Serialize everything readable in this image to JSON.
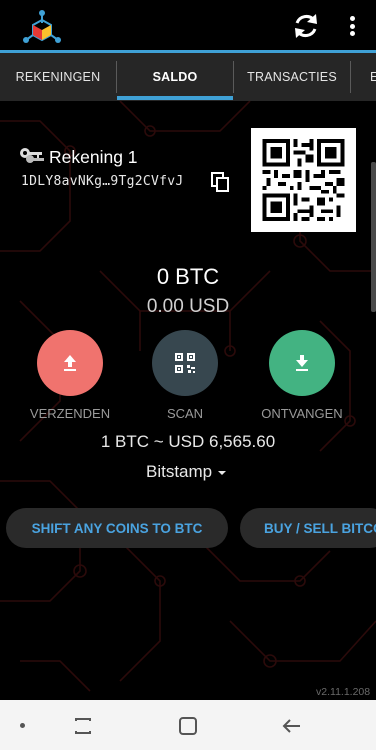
{
  "app": {
    "logo_icon": "app-logo-icon",
    "accent_color": "#3fa1d6"
  },
  "toolbar": {
    "refresh_icon": "refresh-icon",
    "more_icon": "more-vert-icon"
  },
  "tabs": [
    {
      "label": "REKENINGEN",
      "active": false
    },
    {
      "label": "SALDO",
      "active": true
    },
    {
      "label": "TRANSACTIES",
      "active": false
    },
    {
      "label": "E",
      "active": false
    }
  ],
  "account": {
    "icon": "key-icon",
    "name": "Rekening 1",
    "address": "1DLY8avNKg…9Tg2CVfvJ",
    "copy_icon": "copy-icon"
  },
  "balance": {
    "btc": "0 BTC",
    "usd": "0.00 USD"
  },
  "actions": [
    {
      "label": "VERZENDEN",
      "icon": "upload-icon",
      "color": "#f0736e"
    },
    {
      "label": "SCAN",
      "icon": "qr-scan-icon",
      "color": "#37474f"
    },
    {
      "label": "ONTVANGEN",
      "icon": "download-icon",
      "color": "#43b382"
    }
  ],
  "rate": {
    "text": "1 BTC ~ USD 6,565.60",
    "exchange": "Bitstamp"
  },
  "promo": {
    "shift": "SHIFT ANY COINS TO BTC",
    "buy": "BUY / SELL BITCOIN"
  },
  "footer": {
    "version": "v2.11.1.208"
  },
  "navbar": {
    "dot_icon": "nav-dot-icon",
    "recent_icon": "recent-apps-icon",
    "home_icon": "home-icon",
    "back_icon": "back-icon"
  }
}
